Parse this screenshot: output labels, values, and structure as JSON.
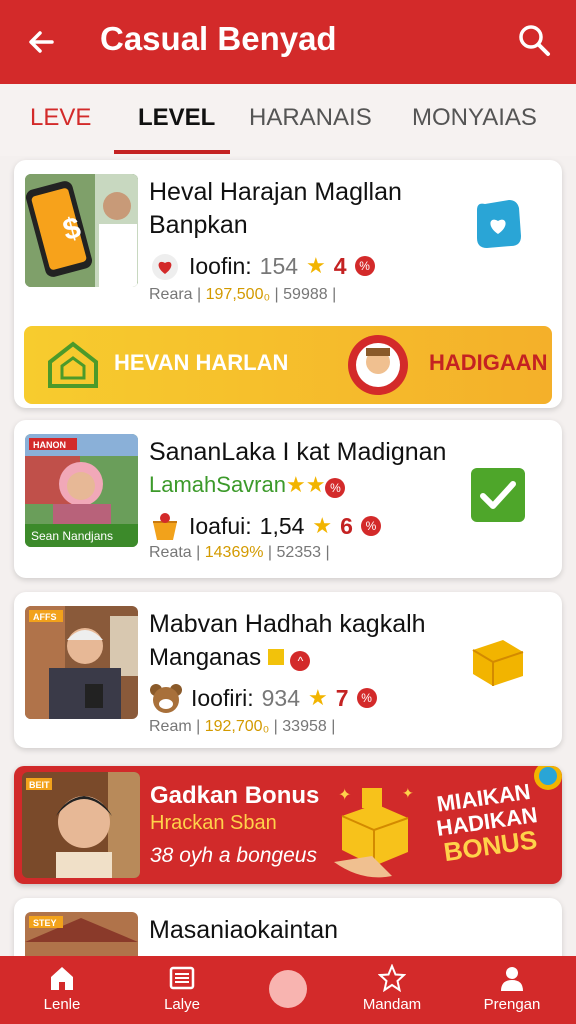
{
  "app": {
    "title": "Casual Benyad"
  },
  "tabs": [
    "LEVE",
    "LEVEL",
    "HARANAIS",
    "MONYAIAS"
  ],
  "cards": [
    {
      "title": "Heval Harajan Magllan Banpkan",
      "meta_label": "Ioofin:",
      "meta_value": "154",
      "rating": "4",
      "sub_a": "Reara",
      "sub_b": "197,500₀",
      "sub_c": "59988"
    },
    {
      "title": "SananLaka I kat Madignan",
      "subtitle": "LamahSavran",
      "thumb_tag": "HANON",
      "thumb_caption": "Sean Nandjans",
      "meta_label": "Ioafui:",
      "meta_value": "1,54",
      "rating": "6",
      "sub_a": "Reata",
      "sub_b": "14369%",
      "sub_c": "52353"
    },
    {
      "title": "Mabvan Hadhah kagkalh",
      "subtitle": "Manganas",
      "thumb_tag": "AFFS",
      "meta_label": "Ioofiri:",
      "meta_value": "934",
      "rating": "7",
      "sub_a": "Ream",
      "sub_b": "192,700₀",
      "sub_c": "33958"
    },
    {
      "title": "Masaniaokaintan",
      "thumb_tag": "STEY"
    }
  ],
  "promo": {
    "label": "HEVAN HARLAN",
    "right": "HADIGAAN"
  },
  "bonus": {
    "title": "Gadkan Bonus",
    "subtitle": "Hrackan Sban",
    "line": "38 oyh a bongeus",
    "tag": "BEIT",
    "big": [
      "MIAIKAN",
      "HADIKAN",
      "BONUS"
    ]
  },
  "bottom_nav": [
    "Lenle",
    "Lalye",
    "Mandam",
    "Prengan"
  ],
  "colors": {
    "primary": "#d32a2a",
    "accent": "#f2b400"
  }
}
